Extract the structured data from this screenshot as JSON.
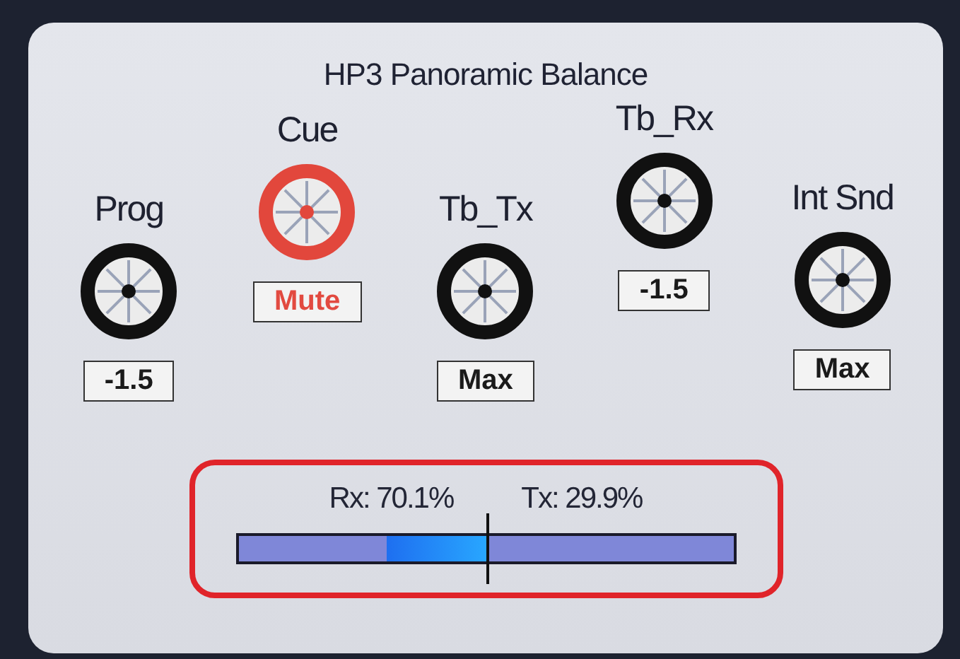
{
  "window": {
    "title": "HP3 Panoramic Balance"
  },
  "channels": [
    {
      "name": "Prog",
      "value": "-1.5",
      "muted": false
    },
    {
      "name": "Cue",
      "value": "Mute",
      "muted": true
    },
    {
      "name": "Tb_Tx",
      "value": "Max",
      "muted": false
    },
    {
      "name": "Tb_Rx",
      "value": "-1.5",
      "muted": false
    },
    {
      "name": "Int Snd",
      "value": "Max",
      "muted": false
    }
  ],
  "balance": {
    "rx_label": "Rx: 70.1%",
    "tx_label": "Tx: 29.9%",
    "level": 0.701
  }
}
